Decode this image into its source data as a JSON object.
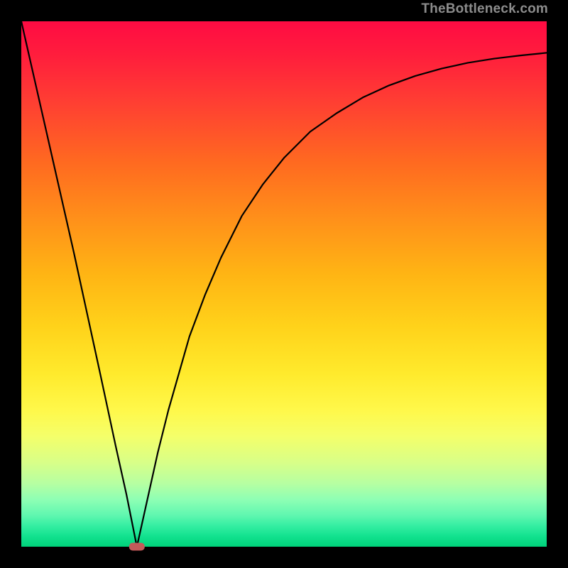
{
  "watermark": "TheBottleneck.com",
  "chart_data": {
    "type": "line",
    "title": "",
    "xlabel": "",
    "ylabel": "",
    "xlim": [
      0,
      100
    ],
    "ylim": [
      0,
      100
    ],
    "grid": false,
    "legend": false,
    "x": [
      0,
      5,
      10,
      15,
      18,
      20,
      21,
      22,
      24,
      26,
      28,
      30,
      32,
      35,
      38,
      42,
      46,
      50,
      55,
      60,
      65,
      70,
      75,
      80,
      85,
      90,
      95,
      100
    ],
    "y": [
      100,
      78,
      56,
      33,
      19,
      10,
      5,
      0,
      9,
      18,
      26,
      33,
      40,
      48,
      55,
      63,
      69,
      74,
      79,
      82.5,
      85.5,
      87.8,
      89.6,
      91,
      92.1,
      92.9,
      93.5,
      94
    ],
    "marker": {
      "x": 22,
      "y": 0,
      "color": "#c35a5a",
      "shape": "pill"
    },
    "background_gradient": {
      "top": "#ff0b43",
      "bottom": "#00d27a"
    }
  }
}
